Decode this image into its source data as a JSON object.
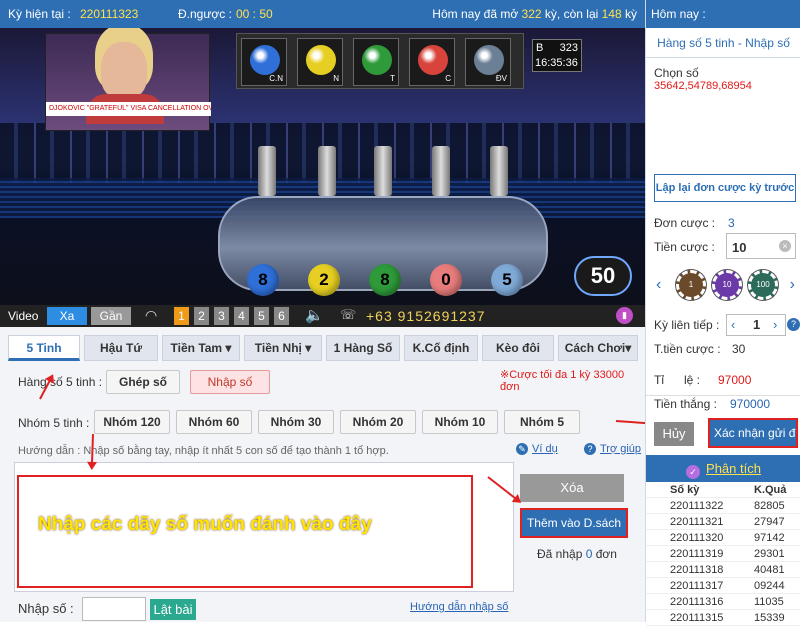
{
  "topbar": {
    "ky_label": "Kỳ hiện tại :",
    "ky_value": "220111323",
    "dnguoc_label": "Đ.ngược :",
    "dnguoc_value": "00 : 50",
    "today_prefix": "Hôm nay đã mở",
    "opened": "322",
    "ky_mid": "kỳ, còn lại",
    "remaining": "148",
    "ky_suffix": "kỳ"
  },
  "video": {
    "ball_labels": [
      "C.N",
      "N",
      "T",
      "C",
      "ĐV"
    ],
    "ball_colors": [
      "#2f6fd8",
      "#e6cf22",
      "#2e9a3a",
      "#d8443c",
      "#6b7f95"
    ],
    "board_letter": "B",
    "board_number": "323",
    "board_time": "16:35:36",
    "result_balls": [
      "8",
      "2",
      "8",
      "0",
      "5"
    ],
    "result_colors": [
      "#2f6fd8",
      "#e6cf22",
      "#2e9a3a",
      "#e87c7c",
      "#7fa9d6"
    ],
    "countdown": "50",
    "news_ticker": "DJOKOVIC \"GRATEFUL\" VISA CANCELLATION OVERTURNED"
  },
  "controls": {
    "video_label": "Video",
    "xa": "Xa",
    "gan": "Gần",
    "numbers": [
      "1",
      "2",
      "3",
      "4",
      "5",
      "6"
    ],
    "phone": "+63 9152691237"
  },
  "tabs": [
    "5 Tinh",
    "Hậu Tứ",
    "Tiền Tam ▾",
    "Tiền Nhị ▾",
    "1 Hàng Số",
    "K.Cố định",
    "Kèo đôi",
    "Cách Chơi▾"
  ],
  "form": {
    "hang_label": "Hàng số 5 tinh :",
    "ghep_so": "Ghép số",
    "nhap_so": "Nhập số",
    "max_note": "※Cược tối đa 1 kỳ 33000 đơn",
    "nhom_label": "Nhóm 5 tinh :",
    "nhom": [
      "Nhóm 120",
      "Nhóm 60",
      "Nhóm 30",
      "Nhóm 20",
      "Nhóm 10",
      "Nhóm 5"
    ],
    "guide": "Hướng dẫn : Nhập số bằng tay, nhập ít nhất 5 con số để tạo thành 1 tổ hợp.",
    "vi_du": "Ví dụ",
    "tro_giup": "Trợ giúp",
    "overlay": "Nhập các dãy số muốn đánh vào đây",
    "xoa": "Xóa",
    "them": "Thêm vào D.sách",
    "da_nhap_prefix": "Đã nhập",
    "da_nhap_value": "0",
    "da_nhap_suffix": "đơn",
    "nhap_so_label": "Nhập số :",
    "lat_bai": "Lật bài",
    "huong_dan_nhap": "Hướng dẫn nhập số"
  },
  "right": {
    "today": "Hôm nay :",
    "title": "Hàng số 5 tinh - Nhập số",
    "chon_so_label": "Chọn số",
    "chon_so_value": "35642,54789,68954",
    "lap_lai": "Lập lại đơn cược kỳ trước",
    "don_cuoc_label": "Đơn cược :",
    "don_cuoc_value": "3",
    "tien_cuoc_label": "Tiền cược :",
    "tien_cuoc_value": "10",
    "chips": [
      "1",
      "10",
      "100"
    ],
    "ky_lien_tiep_label": "Kỳ liên tiếp :",
    "ky_lien_tiep_value": "1",
    "t_tien_cuoc_label": "T.tiền cược :",
    "t_tien_cuoc_value": "30",
    "ti_le_label": "Tỉ      lệ :",
    "ti_le_value": "97000",
    "tien_thang_label": "Tiền thắng :",
    "tien_thang_value": "970000",
    "huy": "Hủy",
    "xac_nhan": "Xác nhận gửi đ",
    "phan_tich": "Phân tích",
    "history_headers": [
      "Số kỳ",
      "K.Quả"
    ],
    "history": [
      [
        "220111322",
        "82805"
      ],
      [
        "220111321",
        "27947"
      ],
      [
        "220111320",
        "97142"
      ],
      [
        "220111319",
        "29301"
      ],
      [
        "220111318",
        "40481"
      ],
      [
        "220111317",
        "09244"
      ],
      [
        "220111316",
        "11035"
      ],
      [
        "220111315",
        "15339"
      ]
    ]
  }
}
